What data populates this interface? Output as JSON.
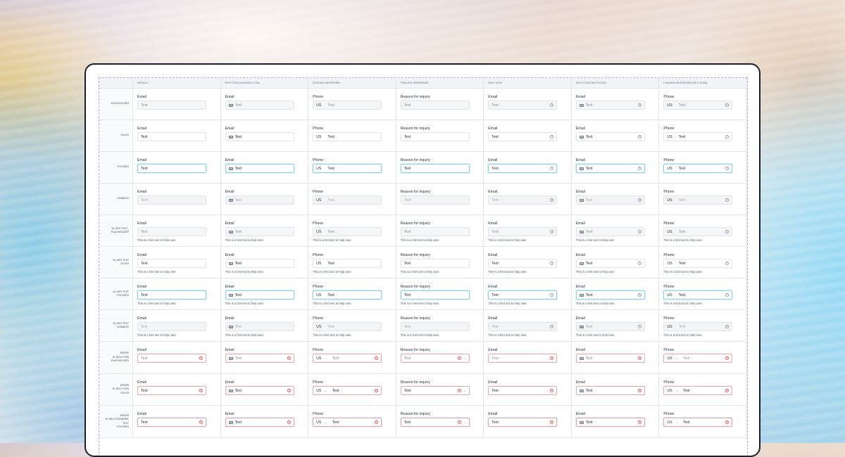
{
  "columns": [
    "Default",
    "With icon (leading icon)",
    "Leading dropdown",
    "Trailing dropdown",
    "Help icon",
    "With icon (help icon)",
    "Leading dropdown (help icon)"
  ],
  "column_kinds": [
    "plain",
    "icon",
    "leading",
    "trailing",
    "help",
    "iconhelp",
    "leadinghelp"
  ],
  "field_labels": [
    "Email",
    "Email",
    "Phone",
    "Reason for inquiry",
    "Email",
    "Email",
    "Phone"
  ],
  "field_value": "Text",
  "country_code": "US",
  "hint_text": "This is a hint text to help user.",
  "rows": [
    {
      "label": [
        "Placeholder"
      ],
      "state": "placeholder",
      "hint": false,
      "error": false
    },
    {
      "label": [
        "Filled"
      ],
      "state": "filled",
      "hint": false,
      "error": false
    },
    {
      "label": [
        "Focused"
      ],
      "state": "focused",
      "hint": false,
      "error": false
    },
    {
      "label": [
        "Disabled"
      ],
      "state": "disabled",
      "hint": false,
      "error": false
    },
    {
      "label": [
        "W_hint text_",
        "Placeholder"
      ],
      "state": "placeholder",
      "hint": true,
      "error": false
    },
    {
      "label": [
        "W_hint text",
        "_Filled"
      ],
      "state": "filled",
      "hint": true,
      "error": false
    },
    {
      "label": [
        "W_hint text",
        "Focused"
      ],
      "state": "focused",
      "hint": true,
      "error": false
    },
    {
      "label": [
        "W_hint text",
        "Disabled"
      ],
      "state": "disabled",
      "hint": true,
      "error": false
    },
    {
      "label": [
        "Error",
        "W_help icon",
        "Placeholder"
      ],
      "state": "placeholder",
      "hint": false,
      "error": true
    },
    {
      "label": [
        "Error",
        "W_help icon",
        "Filled"
      ],
      "state": "filled",
      "hint": false,
      "error": true
    },
    {
      "label": [
        "Error",
        "W_help icon&hint text",
        "Focused"
      ],
      "state": "focused",
      "hint": false,
      "error": true
    }
  ],
  "icons": {
    "mail": "mail-icon",
    "help": "help-circle-icon",
    "error": "error-circle-icon",
    "chevron": "chevron-down-icon"
  }
}
